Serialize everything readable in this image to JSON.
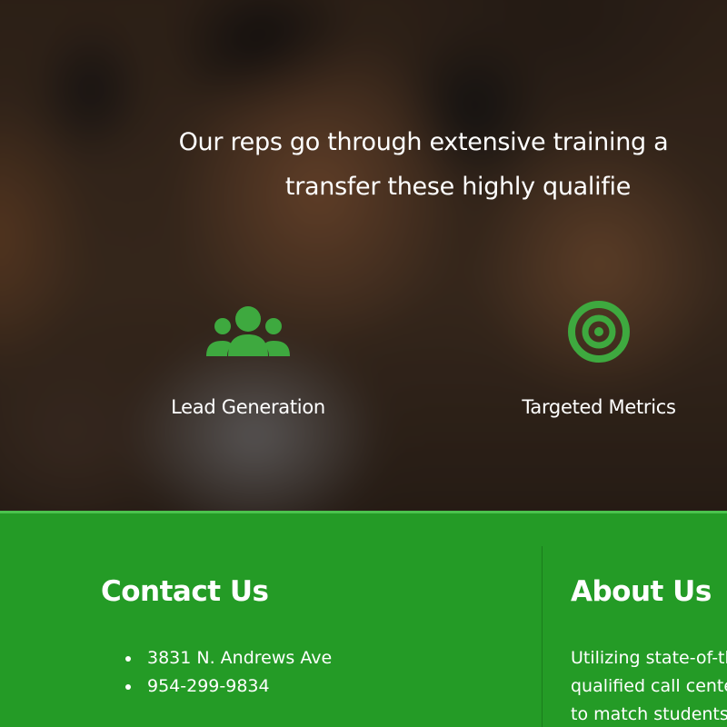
{
  "hero": {
    "tagline_line1": "Our reps go through extensive training a",
    "tagline_line2": "transfer these highly qualifie"
  },
  "features": [
    {
      "label": "Lead Generation",
      "icon": "users-group-icon"
    },
    {
      "label": "Targeted Metrics",
      "icon": "target-icon"
    }
  ],
  "contact": {
    "title": "Contact Us",
    "items": [
      "3831 N. Andrews Ave",
      "954-299-9834"
    ]
  },
  "about": {
    "title": "About Us",
    "lines": [
      "Utilizing state-of-th",
      "qualified call center",
      "to match students w"
    ]
  },
  "colors": {
    "brand_green": "#249b26",
    "icon_green": "#3ea93f",
    "footer_accent": "#4bc24d",
    "text": "#ffffff"
  }
}
